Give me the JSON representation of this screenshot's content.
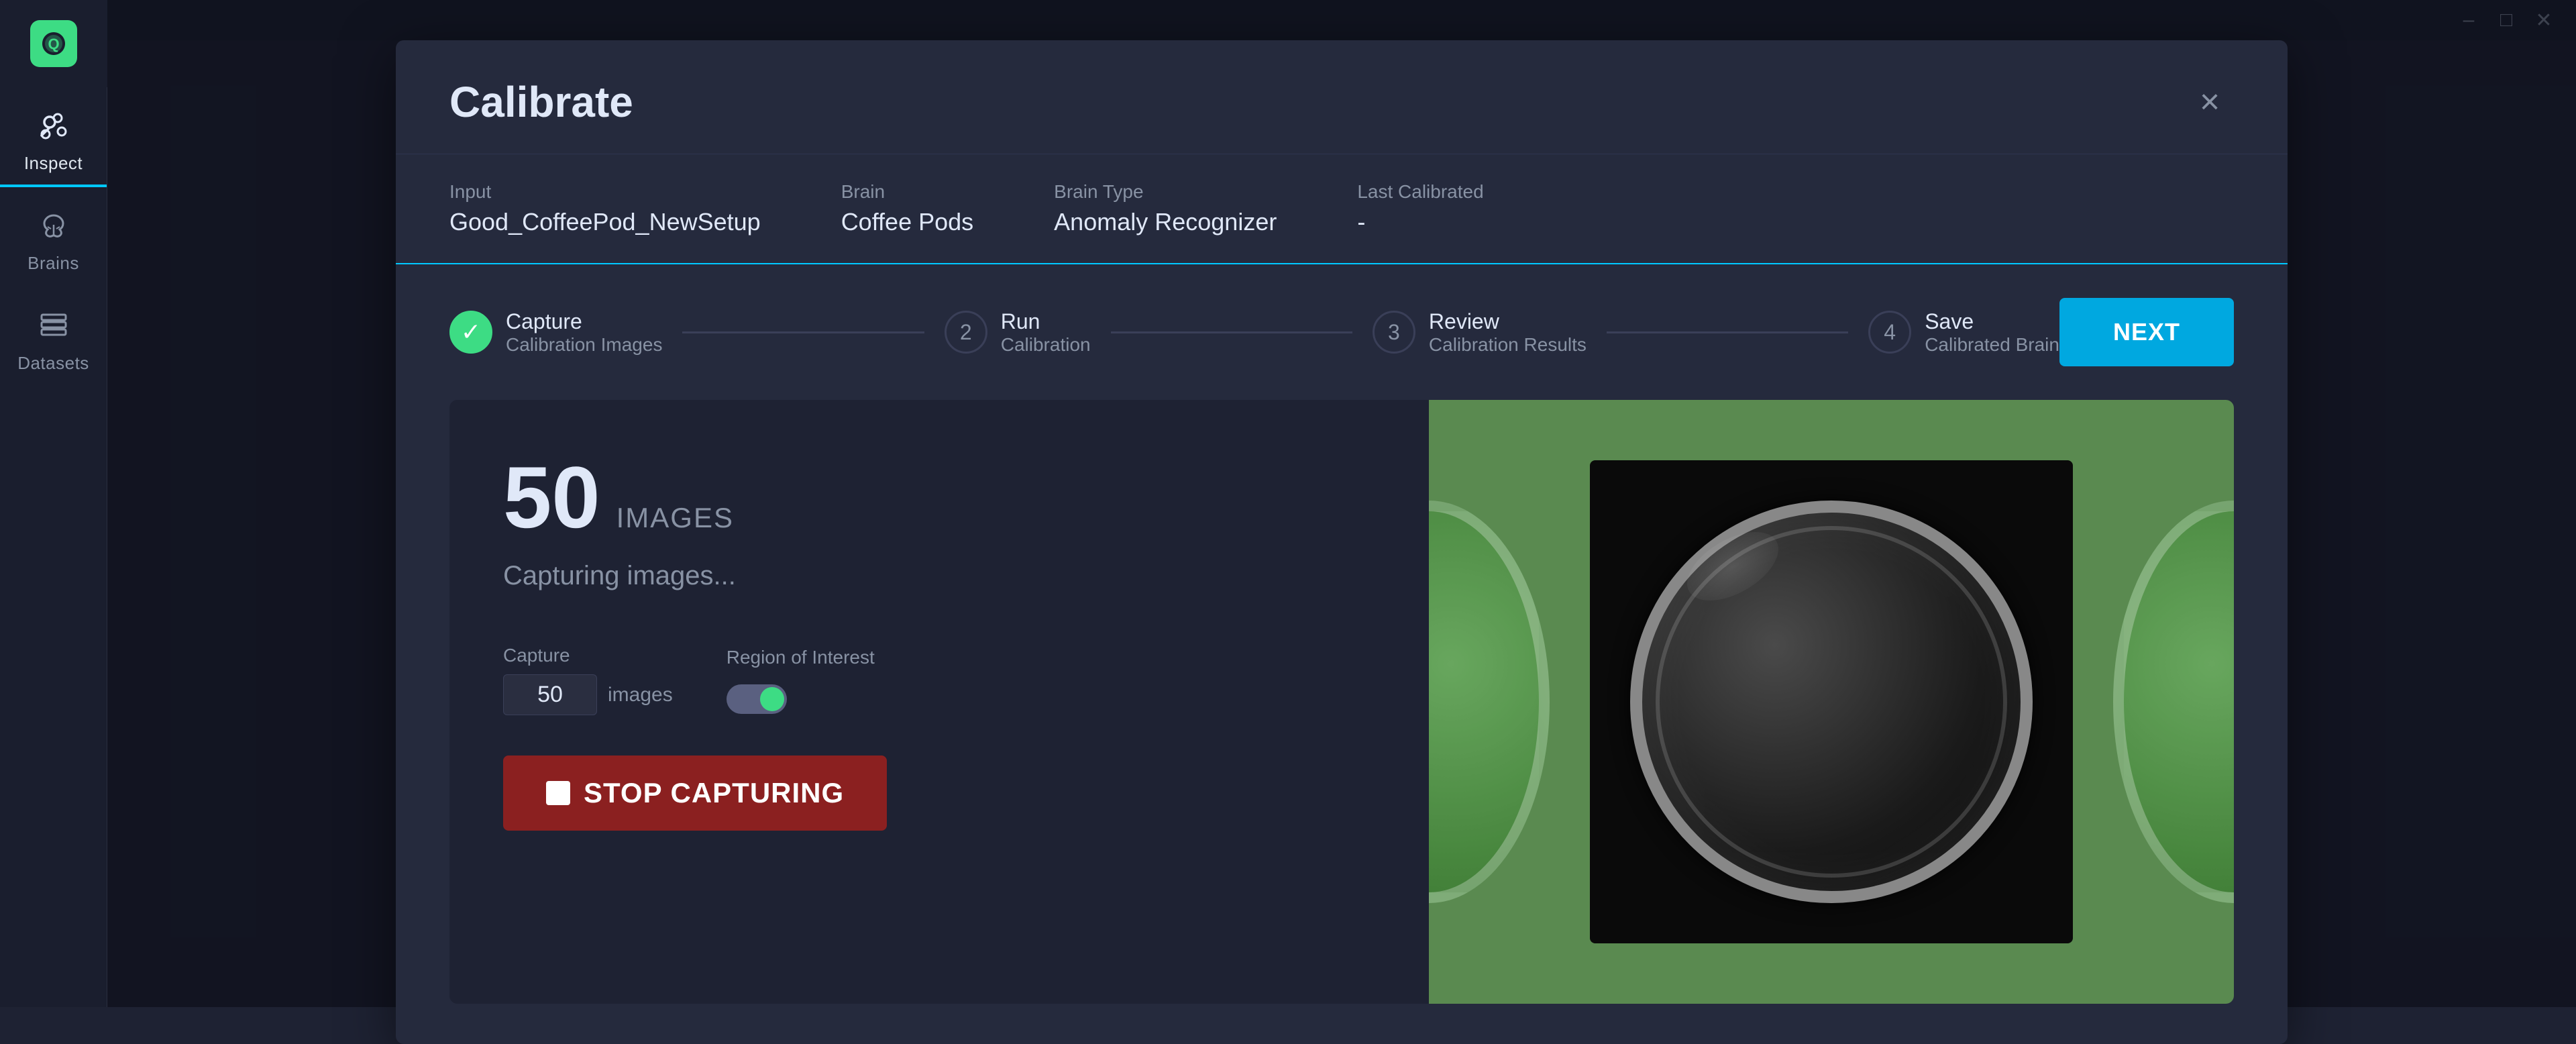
{
  "app": {
    "title": "Calibrate",
    "window_controls": [
      "minimize",
      "maximize",
      "close"
    ]
  },
  "sidebar": {
    "logo_alt": "Qualitas AI logo",
    "items": [
      {
        "id": "inspect",
        "label": "Inspect",
        "icon": "inspect-icon",
        "active": true
      },
      {
        "id": "brains",
        "label": "Brains",
        "icon": "brains-icon",
        "active": false
      },
      {
        "id": "datasets",
        "label": "Datasets",
        "icon": "datasets-icon",
        "active": false
      }
    ]
  },
  "modal": {
    "title": "Calibrate",
    "close_label": "×",
    "meta": {
      "input": {
        "label": "Input",
        "value": "Good_CoffeePod_NewSetup"
      },
      "brain": {
        "label": "Brain",
        "value": "Coffee Pods"
      },
      "brain_type": {
        "label": "Brain Type",
        "value": "Anomaly Recognizer"
      },
      "last_calibrated": {
        "label": "Last Calibrated",
        "value": "-"
      }
    },
    "steps": [
      {
        "number": "✓",
        "title": "Capture",
        "subtitle": "Calibration Images",
        "state": "completed"
      },
      {
        "number": "2",
        "title": "Run",
        "subtitle": "Calibration",
        "state": "pending"
      },
      {
        "number": "3",
        "title": "Review",
        "subtitle": "Calibration Results",
        "state": "pending"
      },
      {
        "number": "4",
        "title": "Save",
        "subtitle": "Calibrated Brain",
        "state": "pending"
      }
    ],
    "next_button": "NEXT",
    "capture": {
      "count": "50",
      "count_unit": "IMAGES",
      "status_text": "Capturing images...",
      "capture_label": "Capture",
      "capture_value": "50",
      "capture_unit": "images",
      "roi_label": "Region of Interest",
      "stop_button": "STOP CAPTURING"
    }
  }
}
